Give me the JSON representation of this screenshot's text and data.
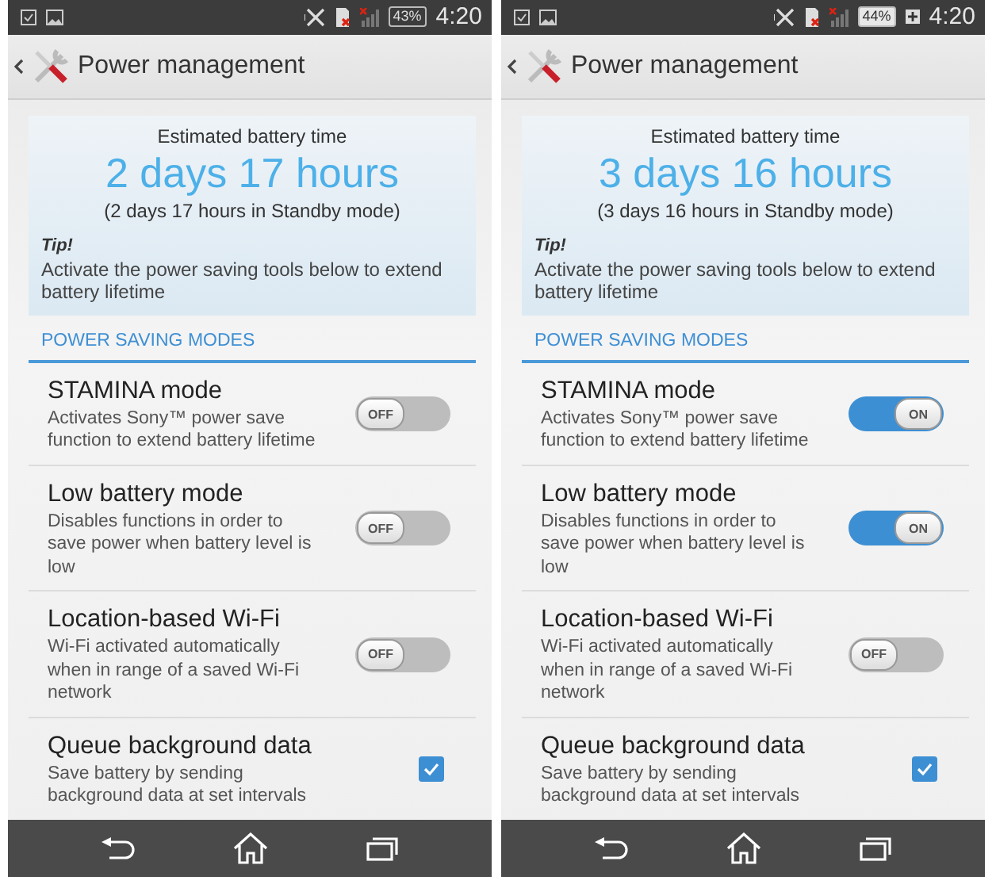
{
  "screens": [
    {
      "status_bar": {
        "battery": "43%",
        "charging": false,
        "time": "4:20"
      },
      "title": "Power management",
      "estimate": {
        "label": "Estimated battery time",
        "value": "2 days 17 hours",
        "standby": "(2 days 17 hours in Standby mode)"
      },
      "tip": {
        "title": "Tip!",
        "text": "Activate the power saving tools below to extend battery lifetime"
      },
      "section_header": "POWER SAVING MODES",
      "settings": [
        {
          "kind": "switch",
          "title": "STAMINA mode",
          "description": "Activates Sony™ power save function to extend battery lifetime",
          "on": false,
          "switch_label": "OFF"
        },
        {
          "kind": "switch",
          "title": "Low battery mode",
          "description": "Disables functions in order to save power when battery level is low",
          "on": false,
          "switch_label": "OFF"
        },
        {
          "kind": "switch",
          "title": "Location-based Wi-Fi",
          "description": "Wi-Fi activated automatically when in range of a saved Wi-Fi network",
          "on": false,
          "switch_label": "OFF"
        },
        {
          "kind": "checkbox",
          "title": "Queue background data",
          "description": "Save battery by sending background data at set intervals",
          "checked": true
        }
      ]
    },
    {
      "status_bar": {
        "battery": "44%",
        "charging": true,
        "time": "4:20"
      },
      "title": "Power management",
      "estimate": {
        "label": "Estimated battery time",
        "value": "3 days 16 hours",
        "standby": "(3 days 16 hours in Standby mode)"
      },
      "tip": {
        "title": "Tip!",
        "text": "Activate the power saving tools below to extend battery lifetime"
      },
      "section_header": "POWER SAVING MODES",
      "settings": [
        {
          "kind": "switch",
          "title": "STAMINA mode",
          "description": "Activates Sony™ power save function to extend battery lifetime",
          "on": true,
          "switch_label": "ON"
        },
        {
          "kind": "switch",
          "title": "Low battery mode",
          "description": "Disables functions in order to save power when battery level is low",
          "on": true,
          "switch_label": "ON"
        },
        {
          "kind": "switch",
          "title": "Location-based Wi-Fi",
          "description": "Wi-Fi activated automatically when in range of a saved Wi-Fi network",
          "on": false,
          "switch_label": "OFF"
        },
        {
          "kind": "checkbox",
          "title": "Queue background data",
          "description": "Save battery by sending background data at set intervals",
          "checked": true
        }
      ]
    }
  ]
}
